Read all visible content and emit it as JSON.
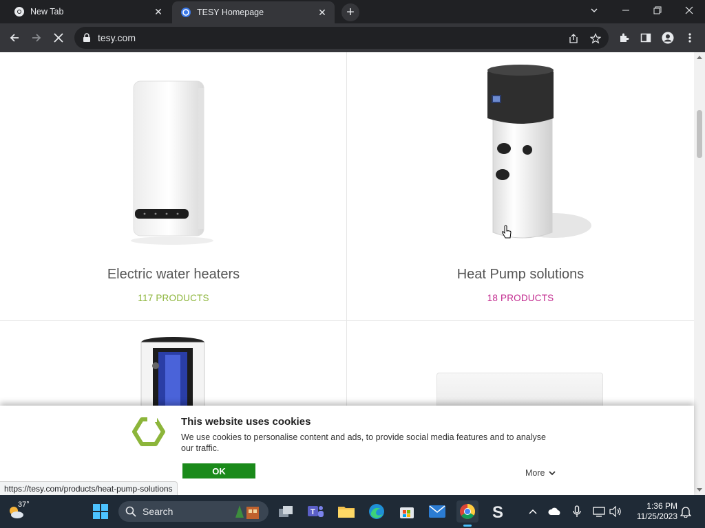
{
  "browser": {
    "tabs": [
      {
        "title": "New Tab",
        "active": false
      },
      {
        "title": "TESY Homepage",
        "active": true
      }
    ],
    "url": "tesy.com",
    "status_url": "https://tesy.com/products/heat-pump-solutions"
  },
  "categories": [
    {
      "name": "Electric water heaters",
      "count": "117 PRODUCTS",
      "color": "#8cb53a"
    },
    {
      "name": "Heat Pump solutions",
      "count": "18 PRODUCTS",
      "color": "#c2288e"
    }
  ],
  "cookie_banner": {
    "title": "This website uses cookies",
    "text": "We use cookies to personalise content and ads, to provide social media features and to analyse our traffic.",
    "ok_label": "OK",
    "more_label": "More"
  },
  "taskbar": {
    "weather_temp": "37°",
    "search_label": "Search",
    "time": "1:36 PM",
    "date": "11/25/2023"
  },
  "colors": {
    "brand_green": "#8cb53a",
    "ok_button": "#1a8a1a"
  }
}
